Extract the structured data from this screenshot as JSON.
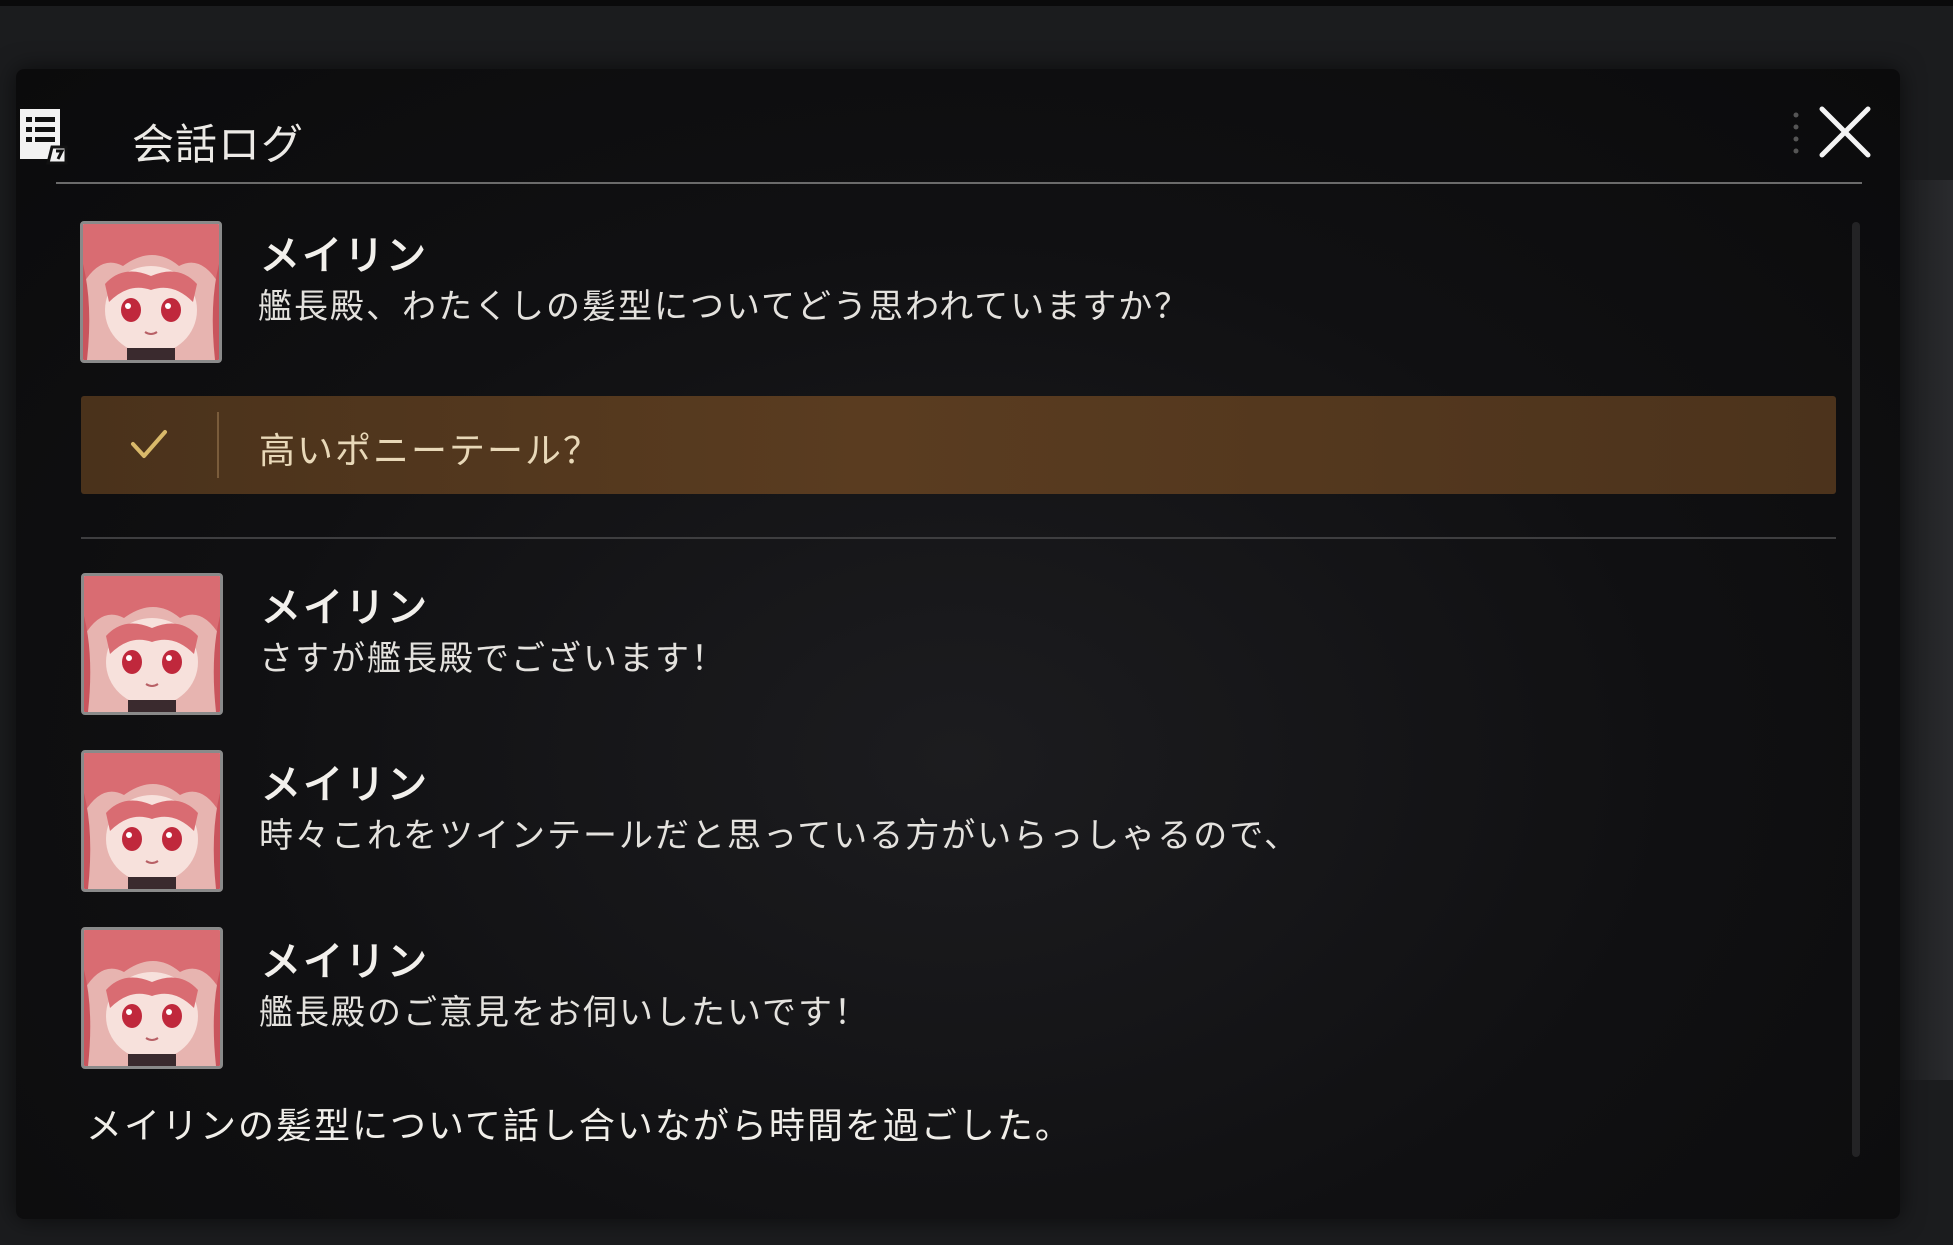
{
  "window": {
    "title": "会話ログ",
    "title_icon": "log-document-icon",
    "close_icon": "close-icon"
  },
  "entries_top": [
    {
      "speaker": "メイリン",
      "text": "艦長殿、わたくしの髪型についてどう思われていますか？",
      "avatar": "meilin-portrait"
    }
  ],
  "choice": {
    "label": "高いポニーテール？",
    "selected_icon": "check-icon"
  },
  "entries_bottom": [
    {
      "speaker": "メイリン",
      "text": "さすが艦長殿でございます！",
      "avatar": "meilin-portrait"
    },
    {
      "speaker": "メイリン",
      "text": "時々これをツインテールだと思っている方がいらっしゃるので、",
      "avatar": "meilin-portrait"
    },
    {
      "speaker": "メイリン",
      "text": "艦長殿のご意見をお伺いしたいです！",
      "avatar": "meilin-portrait"
    }
  ],
  "narration": "メイリンの髪型について話し合いながら時間を過ごした。",
  "colors": {
    "choice_bg": "#54391f",
    "choice_text": "#e8d8b8",
    "check": "#d9b96a",
    "text": "#e4e2de"
  }
}
